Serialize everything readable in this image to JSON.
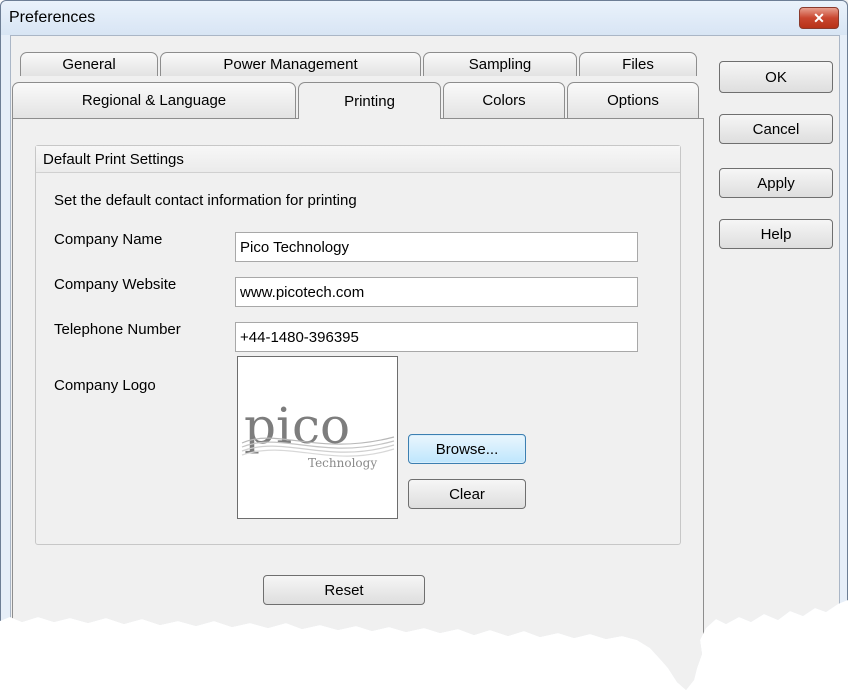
{
  "window": {
    "title": "Preferences",
    "close_label": "✕"
  },
  "tabs": {
    "row1": [
      "General",
      "Power Management",
      "Sampling",
      "Files"
    ],
    "row2": [
      "Regional & Language",
      "Printing",
      "Colors",
      "Options"
    ],
    "active": "Printing"
  },
  "side_buttons": {
    "ok": "OK",
    "cancel": "Cancel",
    "apply": "Apply",
    "help": "Help"
  },
  "print_settings": {
    "group_title": "Default Print Settings",
    "description": "Set the default contact information for printing",
    "company_name_label": "Company Name",
    "company_name_value": "Pico Technology",
    "company_website_label": "Company Website",
    "company_website_value": "www.picotech.com",
    "telephone_label": "Telephone Number",
    "telephone_value": "+44-1480-396395",
    "logo_label": "Company Logo",
    "logo_text": "pico",
    "logo_subtext": "Technology",
    "browse_button": "Browse...",
    "clear_button": "Clear",
    "reset_button": "Reset"
  },
  "colors": {
    "logo_gray": "#7d7d7d",
    "focus_blue": "#3c7fb1"
  }
}
